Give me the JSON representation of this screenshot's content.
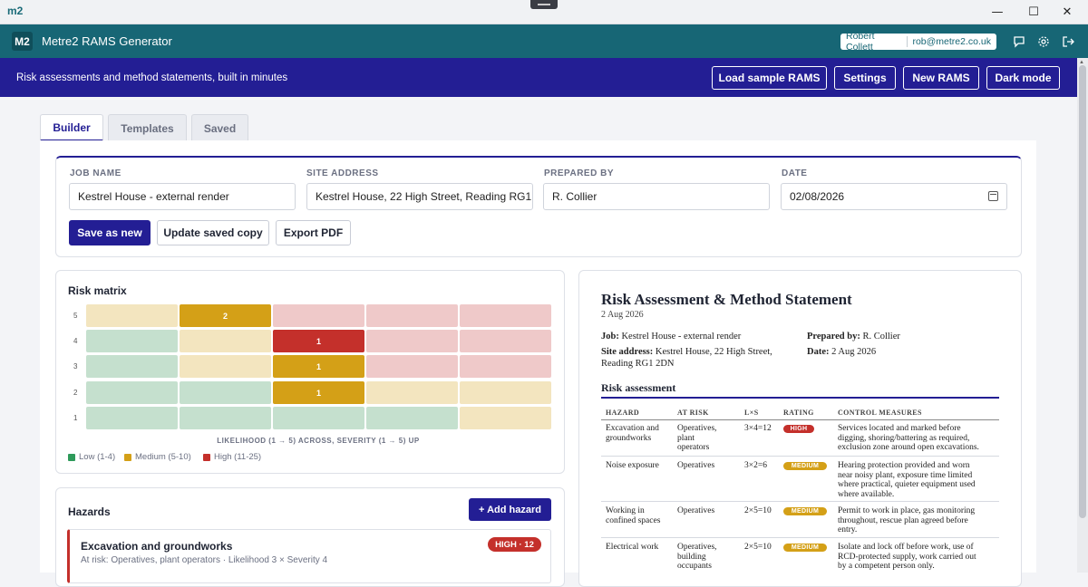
{
  "titlebar": {
    "logo": "m2",
    "minimize": "—",
    "maximize": "☐",
    "close": "✕"
  },
  "app": {
    "logo": "M2",
    "title": "Metre2 RAMS Generator",
    "user_name": "Robert Collett",
    "user_email": "rob@metre2.co.uk"
  },
  "banner": {
    "tagline": "Risk assessments and method statements, built in minutes",
    "load_sample": "Load sample RAMS",
    "settings": "Settings",
    "new_rams": "New RAMS",
    "dark_mode": "Dark mode"
  },
  "tabs": [
    "Builder",
    "Templates",
    "Saved"
  ],
  "job": {
    "labels": {
      "job_name": "JOB NAME",
      "site_address": "SITE ADDRESS",
      "prepared_by": "PREPARED BY",
      "date": "DATE"
    },
    "values": {
      "job_name": "Kestrel House - external render",
      "site_address": "Kestrel House, 22 High Street, Reading RG1 2DN",
      "prepared_by": "R. Collier",
      "date": "02/08/2026"
    },
    "buttons": {
      "save_new": "Save as new",
      "update": "Update saved copy",
      "export": "Export PDF"
    }
  },
  "matrix": {
    "title": "Risk matrix",
    "rows": [
      "5",
      "4",
      "3",
      "2",
      "1"
    ],
    "counts": {
      "r5": [
        "",
        "2",
        "",
        "",
        ""
      ],
      "r4": [
        "",
        "",
        "1",
        "",
        ""
      ],
      "r3": [
        "",
        "",
        "1",
        "",
        ""
      ],
      "r2": [
        "",
        "",
        "1",
        "",
        ""
      ],
      "r1": [
        "",
        "",
        "",
        "",
        ""
      ]
    },
    "axis_caption": "LIKELIHOOD (1 → 5) ACROSS, SEVERITY (1 → 5) UP",
    "legend": {
      "low": "Low (1-4)",
      "medium": "Medium (5-10)",
      "high": "High (11-25)"
    },
    "colors": {
      "low": "#2e9a5a",
      "medium": "#d4a017",
      "high": "#c4302b"
    }
  },
  "hazards": {
    "title": "Hazards",
    "add_label": "+ Add hazard",
    "items": [
      {
        "title": "Excavation and groundworks",
        "sub": "At risk: Operatives, plant operators · Likelihood 3 × Severity 4",
        "badge": "HIGH · 12"
      }
    ]
  },
  "doc": {
    "title": "Risk Assessment & Method Statement",
    "date": "2 Aug 2026",
    "job_label": "Job:",
    "job": "Kestrel House - external render",
    "site_label": "Site address:",
    "site_line1": "Kestrel House, 22 High Street,",
    "site_line2": "Reading RG1 2DN",
    "prepared_label": "Prepared by:",
    "prepared": "R. Collier",
    "date_label": "Date:",
    "date_value": "2 Aug 2026",
    "section": "Risk assessment",
    "headers": {
      "hazard": "HAZARD",
      "at_risk": "AT RISK",
      "lxs": "L×S",
      "rating": "RATING",
      "controls": "CONTROL MEASURES"
    },
    "rows": [
      {
        "h1": "Excavation and",
        "h2": "groundworks",
        "h3": "",
        "a1": "Operatives,",
        "a2": "plant",
        "a3": "operators",
        "lxs": "3×4=12",
        "rating": "HIGH",
        "c1": "Services located and marked before",
        "c2": "digging, shoring/battering as required,",
        "c3": "exclusion zone around open excavations.",
        "c4": ""
      },
      {
        "h1": "Noise exposure",
        "h2": "",
        "h3": "",
        "a1": "Operatives",
        "a2": "",
        "a3": "",
        "lxs": "3×2=6",
        "rating": "MEDIUM",
        "c1": "Hearing protection provided and worn",
        "c2": "near noisy plant, exposure time limited",
        "c3": "where practical, quieter equipment used",
        "c4": "where available."
      },
      {
        "h1": "Working in",
        "h2": "confined spaces",
        "h3": "",
        "a1": "Operatives",
        "a2": "",
        "a3": "",
        "lxs": "2×5=10",
        "rating": "MEDIUM",
        "c1": "Permit to work in place, gas monitoring",
        "c2": "throughout, rescue plan agreed before",
        "c3": "entry.",
        "c4": ""
      },
      {
        "h1": "Electrical work",
        "h2": "",
        "h3": "",
        "a1": "Operatives,",
        "a2": "building",
        "a3": "occupants",
        "lxs": "2×5=10",
        "rating": "MEDIUM",
        "c1": "Isolate and lock off before work, use of",
        "c2": "RCD-protected supply, work carried out",
        "c3": "by a competent person only.",
        "c4": ""
      }
    ]
  }
}
